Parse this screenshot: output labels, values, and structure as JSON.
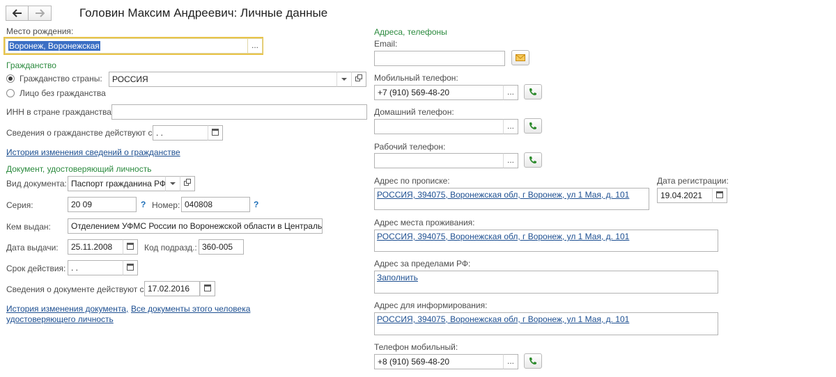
{
  "header": {
    "back_icon": "arrow-left-icon",
    "forward_icon": "arrow-right-icon",
    "title": "Головин Максим Андреевич: Личные данные"
  },
  "left": {
    "birth_place": {
      "label": "Место рождения:",
      "value": "Воронеж, Воронежская",
      "button": "..."
    },
    "citizenship_section": "Гражданство",
    "citizenship": {
      "radio_country_label": "Гражданство страны:",
      "country_value": "РОССИЯ",
      "radio_stateless_label": "Лицо без гражданства",
      "selected": "country"
    },
    "inn": {
      "label": "ИНН в стране гражданства:",
      "value": ""
    },
    "citizenship_valid": {
      "label": "Сведения о гражданстве действуют с:",
      "value": " .  ."
    },
    "citizenship_history_link": "История изменения сведений о гражданстве",
    "document_section": "Документ, удостоверяющий личность",
    "doc_type": {
      "label": "Вид документа:",
      "value": "Паспорт гражданина РФ"
    },
    "series": {
      "label": "Серия:",
      "value": "20 09",
      "help": "?"
    },
    "number": {
      "label": "Номер:",
      "value": "040808",
      "help": "?"
    },
    "issued_by": {
      "label": "Кем выдан:",
      "value": "Отделением УФМС России по  Воронежской области в Центрально"
    },
    "issue_date": {
      "label": "Дата выдачи:",
      "value": "25.11.2008"
    },
    "dept_code": {
      "label": "Код подразд.:",
      "value": "360-005"
    },
    "expiry": {
      "label": "Срок действия:",
      "value": " .  ."
    },
    "doc_valid": {
      "label": "Сведения о документе действуют с:",
      "value": "17.02.2016"
    },
    "doc_history_link_line1": "История изменения документа,",
    "doc_history_link_line2": "удостоверяющего личность",
    "all_docs_link": "Все документы этого человека"
  },
  "right": {
    "section": "Адреса, телефоны",
    "email": {
      "label": "Email:",
      "value": ""
    },
    "mobile": {
      "label": "Мобильный телефон:",
      "value": "+7 (910) 569-48-20"
    },
    "home_phone": {
      "label": "Домашний телефон:",
      "value": ""
    },
    "work_phone": {
      "label": "Рабочий телефон:",
      "value": ""
    },
    "reg_address": {
      "label": "Адрес по прописке:",
      "value": "РОССИЯ, 394075, Воронежская обл, г Воронеж, ул 1 Мая, д. 101"
    },
    "reg_date": {
      "label": "Дата регистрации:",
      "value": "19.04.2021"
    },
    "live_address": {
      "label": "Адрес места проживания:",
      "value": "РОССИЯ, 394075, Воронежская обл, г Воронеж, ул 1 Мая, д. 101"
    },
    "abroad_address": {
      "label": "Адрес за пределами РФ:",
      "value": "Заполнить"
    },
    "info_address": {
      "label": "Адрес для информирования:",
      "value": "РОССИЯ, 394075, Воронежская обл, г Воронеж, ул 1 Мая, д. 101"
    },
    "mobile2": {
      "label": "Телефон мобильный:",
      "value": "+8 (910) 569-48-20"
    }
  },
  "colors": {
    "section_green": "#2b8a3e",
    "link_blue": "#1d4f91",
    "focus_yellow": "#e8c44a",
    "phone_green": "#2e8b2e",
    "envelope_orange": "#e3a21a"
  }
}
